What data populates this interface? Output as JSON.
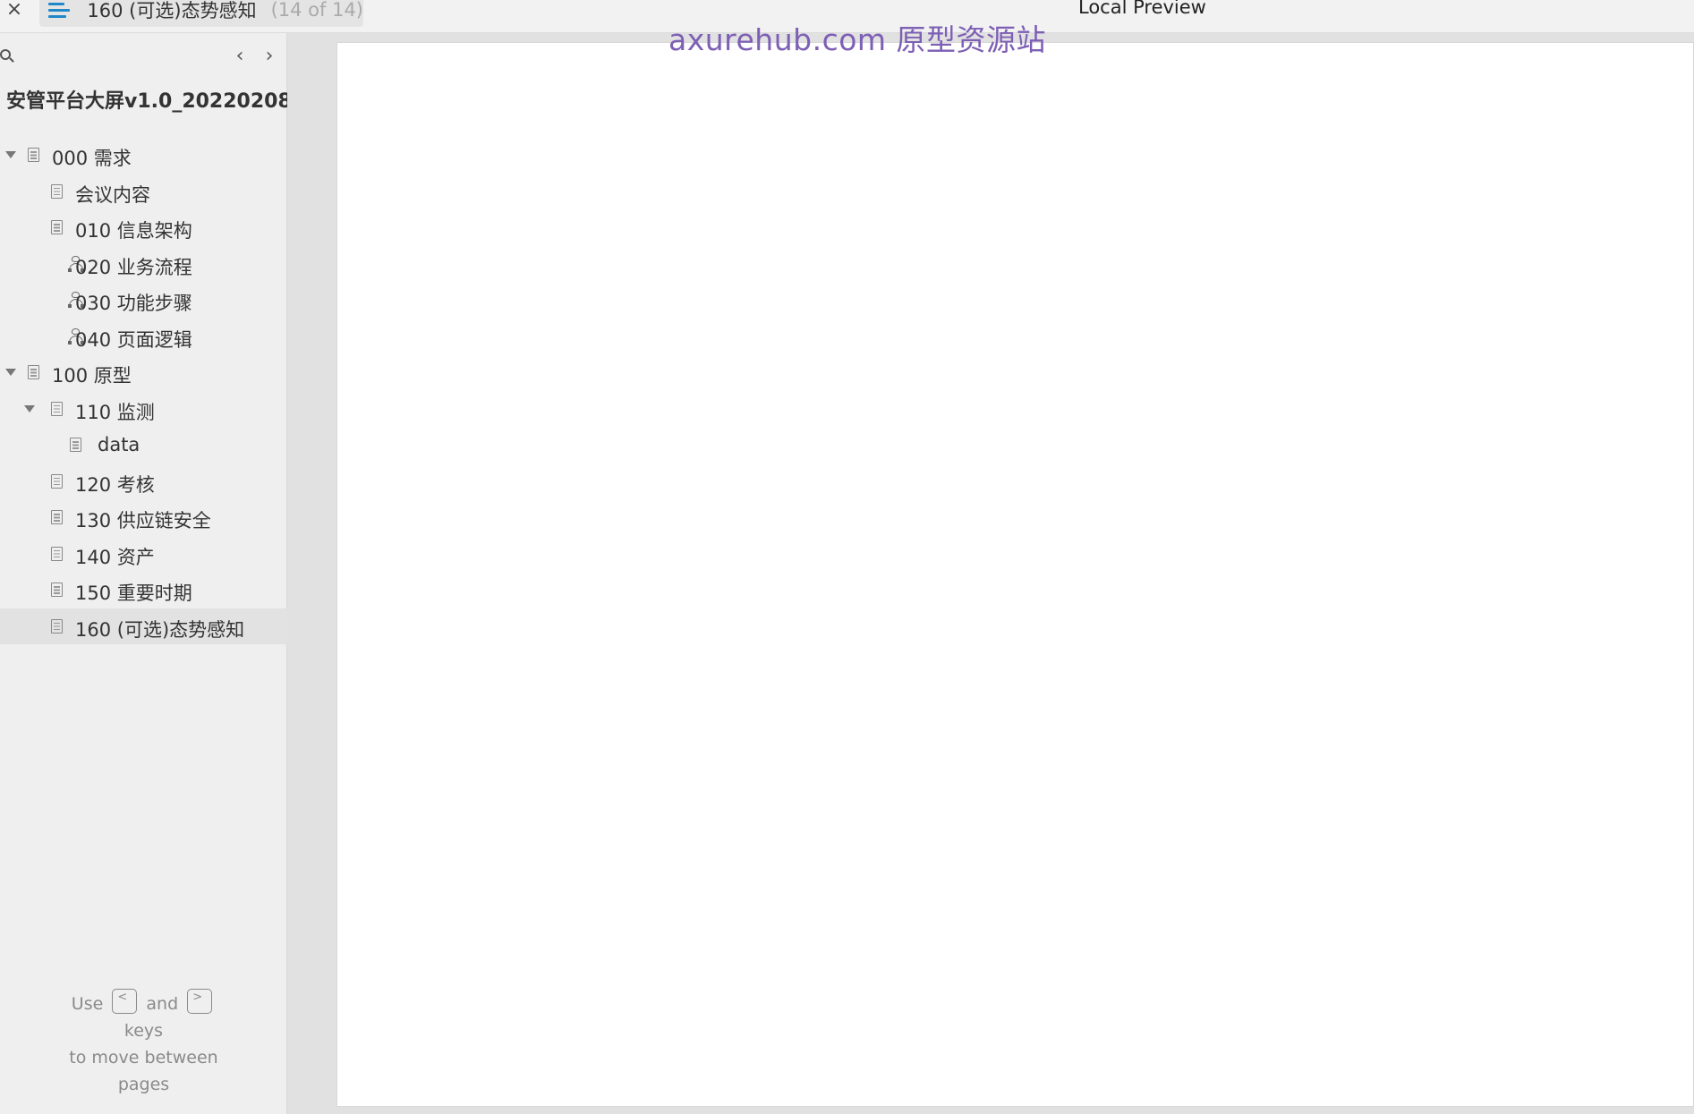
{
  "topbar": {
    "close_glyph": "×",
    "current_page": "160 (可选)态势感知",
    "page_count": "(14 of 14)",
    "preview_label": "Local Preview",
    "watermark": "axurehub.com 原型资源站",
    "menu_icon": "hamburger-menu-icon"
  },
  "sidebar": {
    "search_icon": "search-icon",
    "prev_glyph": "‹",
    "next_glyph": "›",
    "project_title": "安管平台大屏v1.0_20220208",
    "items": [
      {
        "label": "000 需求",
        "icon": "page",
        "level": 0,
        "expanded": true
      },
      {
        "label": "会议内容",
        "icon": "page",
        "level": 1
      },
      {
        "label": "010 信息架构",
        "icon": "page",
        "level": 1
      },
      {
        "label": "020 业务流程",
        "icon": "flow",
        "level": 1
      },
      {
        "label": "030 功能步骤",
        "icon": "flow",
        "level": 1
      },
      {
        "label": "040 页面逻辑",
        "icon": "flow",
        "level": 1
      },
      {
        "label": "100 原型",
        "icon": "page",
        "level": 0,
        "expanded": true
      },
      {
        "label": "110 监测",
        "icon": "page",
        "level": 1,
        "expanded": true
      },
      {
        "label": "data",
        "icon": "page",
        "level": 2
      },
      {
        "label": "120 考核",
        "icon": "page",
        "level": 1
      },
      {
        "label": "130 供应链安全",
        "icon": "page",
        "level": 1
      },
      {
        "label": "140 资产",
        "icon": "page",
        "level": 1
      },
      {
        "label": "150 重要时期",
        "icon": "page",
        "level": 1
      },
      {
        "label": "160 (可选)态势感知",
        "icon": "page",
        "level": 1,
        "selected": true
      }
    ],
    "hint": {
      "use": "Use",
      "and": "and",
      "keys": "keys",
      "line2": "to move between",
      "line3": "pages",
      "key_prev": "<",
      "key_next": ">"
    }
  }
}
